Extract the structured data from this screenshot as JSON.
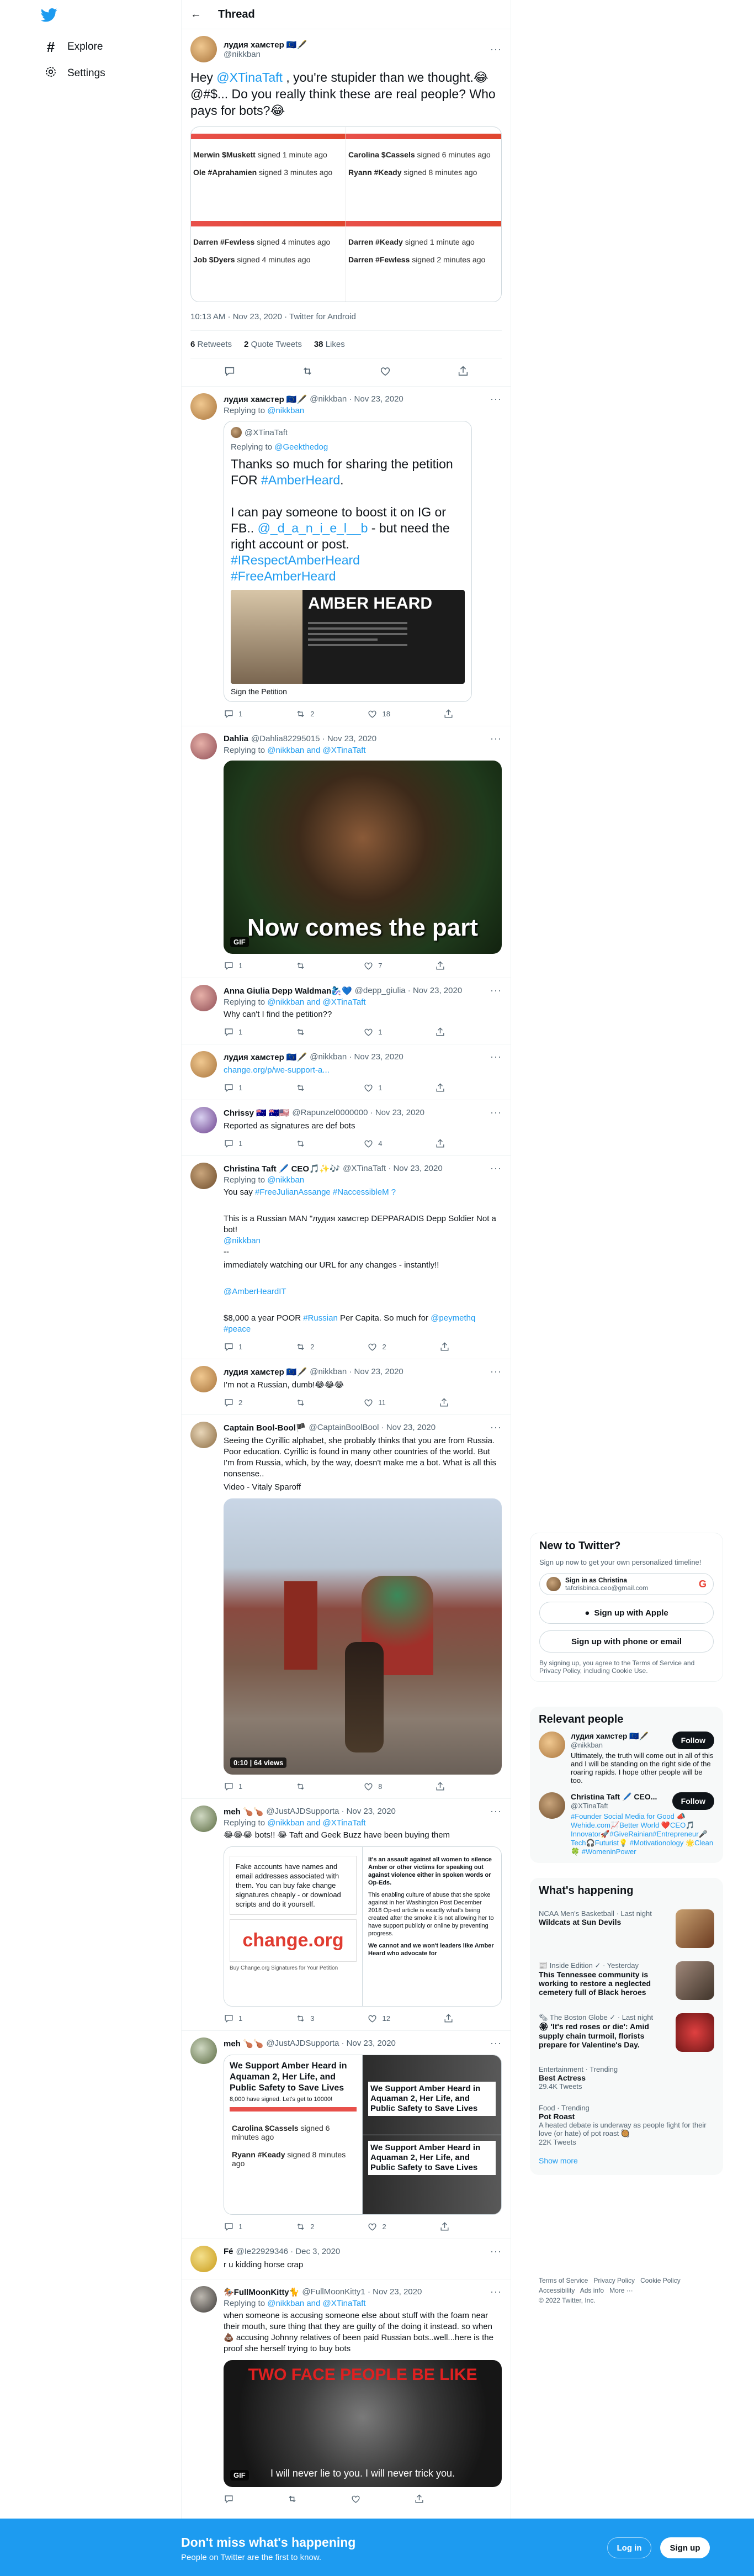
{
  "nav": {
    "explore": "Explore",
    "settings": "Settings"
  },
  "header": {
    "title": "Thread"
  },
  "focus": {
    "name": "лудия хамстер 🇪🇺🖋️",
    "handle": "@nikkban",
    "text_parts": [
      "Hey ",
      "@XTinaTaft",
      " , you're stupider than we thought.😂 @#$... Do you really think these are real people? Who pays for bots?😂"
    ],
    "petitions": [
      {
        "a": "Merwin $Muskett",
        "a_time": "signed 1 minute ago",
        "b": "Carolina $Cassels",
        "b_time": "signed 6 minutes ago"
      },
      {
        "a": "Ole #Aprahamien",
        "a_time": "signed 3 minutes ago",
        "b": "Ryann #Keady",
        "b_time": "signed 8 minutes ago"
      },
      {
        "a": "Darren #Fewless",
        "a_time": "signed 4 minutes ago",
        "b": "Darren #Keady",
        "b_time": "signed 1 minute ago"
      },
      {
        "a": "Job $Dyers",
        "a_time": "signed 4 minutes ago",
        "b": "Darren #Fewless",
        "b_time": "signed 2 minutes ago"
      }
    ],
    "meta": "10:13 AM · Nov 23, 2020 · Twitter for Android",
    "retweets": "6",
    "retweets_label": "Retweets",
    "quotes": "2",
    "quotes_label": "Quote Tweets",
    "likes": "38",
    "likes_label": "Likes"
  },
  "replies": [
    {
      "name": "лудия хамстер 🇪🇺🖋️",
      "handle": "@nikkban · Nov 23, 2020",
      "replying_label": "Replying to",
      "replying": "@nikkban",
      "quote_name": "@XTinaTaft",
      "quote_reply_label": "Replying to",
      "quote_reply": "@Geekthedog",
      "quote_text_1": "Thanks so much for sharing the petition FOR ",
      "quote_link_1": "#AmberHeard",
      "quote_text_2": "I can pay someone to boost it on IG or FB.. ",
      "quote_link_2": "@_d_a_n_i_e_l__b",
      "quote_text_3": " - but need the right account or post. ",
      "quote_link_3": "#IRespectAmberHeard #FreeAmberHeard",
      "banner_title": "AMBER HEARD",
      "banner_caption": "Sign the Petition",
      "replies": "1",
      "rts": "2",
      "likes": "18"
    },
    {
      "name": "Dahlia",
      "handle": "@Dahlia82295015 · Nov 23, 2020",
      "replying_label": "Replying to",
      "replying": "@nikkban and @XTinaTaft",
      "gif_caption": "Now comes the part",
      "gif_badge": "GIF",
      "replies": "1",
      "rts": "",
      "likes": "7"
    },
    {
      "name": "Anna Giulia Depp Waldman🧞‍♀️💙",
      "handle": "@depp_giulia · Nov 23, 2020",
      "replying_label": "Replying to",
      "replying": "@nikkban and @XTinaTaft",
      "text": "Why can't I find the petition??",
      "replies": "1",
      "rts": "",
      "likes": "1"
    },
    {
      "name": "лудия хамстер 🇪🇺🖋️",
      "handle": "@nikkban · Nov 23, 2020",
      "text_link": "change.org/p/we-support-a...",
      "replies": "1",
      "rts": "",
      "likes": "1"
    },
    {
      "name": "Chrissy 🇦🇺 🇦🇺🇺🇸",
      "handle": "@Rapunzel0000000 · Nov 23, 2020",
      "text": "Reported as signatures are def bots",
      "replies": "1",
      "rts": "",
      "likes": "4"
    },
    {
      "name": "Christina Taft 🖊️ CEO🎵✨🎶",
      "handle": "@XTinaTaft · Nov 23, 2020",
      "replying_label": "Replying to",
      "replying": "@nikkban",
      "line1a": "You say ",
      "line1b": "#FreeJulianAssange #NaccessibleM ?",
      "line2": "This is a Russian MAN \"лудия хамстер DEPPARADIS Depp Soldier Not a bot!",
      "line2b": "@nikkban",
      "line3": "immediately watching our URL for any changes - instantly!!",
      "line4": "@AmberHeardIT",
      "line5a": "$8,000 a year POOR ",
      "line5b": "#Russian",
      "line5c": " Per Capita. So much for ",
      "line5d": "@peymethq #peace",
      "replies": "1",
      "rts": "2",
      "likes": "2"
    },
    {
      "name": "лудия хамстер 🇪🇺🖋️",
      "handle": "@nikkban · Nov 23, 2020",
      "text": "I'm not a Russian, dumb!😂😂😂",
      "replies": "2",
      "rts": "",
      "likes": "11"
    },
    {
      "name": "Captain Bool-Bool🏴",
      "handle": "@CaptainBoolBool · Nov 23, 2020",
      "text": "Seeing the Cyrillic alphabet, she probably thinks that you are from Russia. Poor education. Cyrillic is found in many other countries of the world. But I'm from Russia, which, by the way, doesn't make me a bot. What is all this nonsense..",
      "text2": "Video - Vitaly Sparoff",
      "video_badge": "0:10 | 64 views",
      "replies": "1",
      "rts": "",
      "likes": "8"
    },
    {
      "name": "meh 🍗🍗",
      "handle": "@JustAJDSupporta · Nov 23, 2020",
      "replying_label": "Replying to",
      "replying": "@nikkban and @XTinaTaft",
      "text": "😂😂😂 bots!! 😂 Taft and Geek Buzz have been buying them",
      "img1_text": "Fake accounts have names and email addresses associated with them. You can buy fake change signatures cheaply - or download scripts and do it yourself.",
      "img1_brand": "change.org",
      "img1_caption": "Buy Change.org Signatures for Your Petition",
      "img2_head": "It's an assault against all women to silence Amber or other victims for speaking out against violence either in spoken words or Op-Eds.",
      "img2_body": "This enabling culture of abuse that she spoke against in her Washington Post December 2018 Op-ed article is exactly what's being created after the smoke it is not allowing her to have support publicly or online by preventing progress.",
      "img2_bullet": "We cannot and we won't leaders like Amber Heard who advocate for",
      "replies": "1",
      "rts": "3",
      "likes": "12"
    },
    {
      "name": "meh 🍗🍗",
      "handle": "@JustAJDSupporta · Nov 23, 2020",
      "petition_title": "We Support Amber Heard in Aquaman 2, Her Life, and Public Safety to Save Lives",
      "petition_signed": "8,000 have signed. Let's get to 10000!",
      "sig_a": "Carolina $Cassels",
      "sig_a_time": "signed 6 minutes ago",
      "sig_b": "Ryann #Keady",
      "sig_b_time": "signed 8 minutes ago",
      "replies": "1",
      "rts": "2",
      "likes": "2"
    },
    {
      "name": "Fé",
      "handle": "@Ie22929346 · Dec 3, 2020",
      "text": "r u kidding horse crap",
      "replies": "",
      "rts": "",
      "likes": ""
    },
    {
      "name": "🏇FullMoonKitty🐈",
      "handle": "@FullMoonKitty1 · Nov 23, 2020",
      "replying_label": "Replying to",
      "replying": "@nikkban and @XTinaTaft",
      "text": "when someone is accusing someone else about stuff with the foam near their mouth, sure thing that they are guilty of the doing it instead. so when 💩 accusing Johnny relatives of been paid Russian bots..well...here is the proof she herself trying to buy bots",
      "gif_top": "TWO FACE PEOPLE BE LIKE",
      "gif_sub": "I will never lie to you. I will never trick you.",
      "gif_badge": "GIF",
      "replies": "",
      "rts": "",
      "likes": ""
    }
  ],
  "right": {
    "new_title": "New to Twitter?",
    "new_sub": "Sign up now to get your own personalized timeline!",
    "google_name": "Sign in as Christina",
    "google_email": "tafcrisbinca.ceo@gmail.com",
    "apple": "Sign up with Apple",
    "phone": "Sign up with phone or email",
    "terms": "By signing up, you agree to the Terms of Service and Privacy Policy, including Cookie Use.",
    "relevant_title": "Relevant people",
    "people": [
      {
        "name": "лудия хамстер 🇪🇺🖋️",
        "handle": "@nikkban",
        "bio": "Ultimately, the truth will come out in all of this and I will be standing on the right side of the roaring rapids. I hope other people will be too.",
        "follow": "Follow"
      },
      {
        "name": "Christina Taft 🖊️ CEO...",
        "handle": "@XTinaTaft",
        "bio": "#Founder Social Media for Good 📣Wehide.com📈Better World ❤️CEO🎵 Innovator🚀#GiveRainian#Entrepreneur🎤Tech🎧Futurist💡 #Motivationology 🌟Clean🍀 #WomeninPower",
        "follow": "Follow"
      }
    ],
    "happening_title": "What's happening",
    "trends": [
      {
        "meta": "NCAA Men's Basketball · Last night",
        "title": "Wildcats at Sun Devils"
      },
      {
        "meta": "📰 Inside Edition ✓ · Yesterday",
        "title": "This Tennessee community is working to restore a neglected cemetery full of Black heroes"
      },
      {
        "meta": "🗞 The Boston Globe ✓ · Last night",
        "title": "🏵 'It's red roses or die': Amid supply chain turmoil, florists prepare for Valentine's Day."
      },
      {
        "meta": "Entertainment · Trending",
        "title": "Best Actress",
        "count": "29.4K Tweets"
      },
      {
        "meta": "Food · Trending",
        "title": "Pot Roast",
        "count": "A heated debate is underway as people fight for their love (or hate) of pot roast 🥘",
        "count2": "22K Tweets"
      }
    ],
    "show_more": "Show more",
    "footer": [
      "Terms of Service",
      "Privacy Policy",
      "Cookie Policy",
      "Accessibility",
      "Ads info",
      "More ···",
      "© 2022 Twitter, Inc."
    ]
  },
  "bottom": {
    "title": "Don't miss what's happening",
    "sub": "People on Twitter are the first to know.",
    "login": "Log in",
    "signup": "Sign up"
  }
}
